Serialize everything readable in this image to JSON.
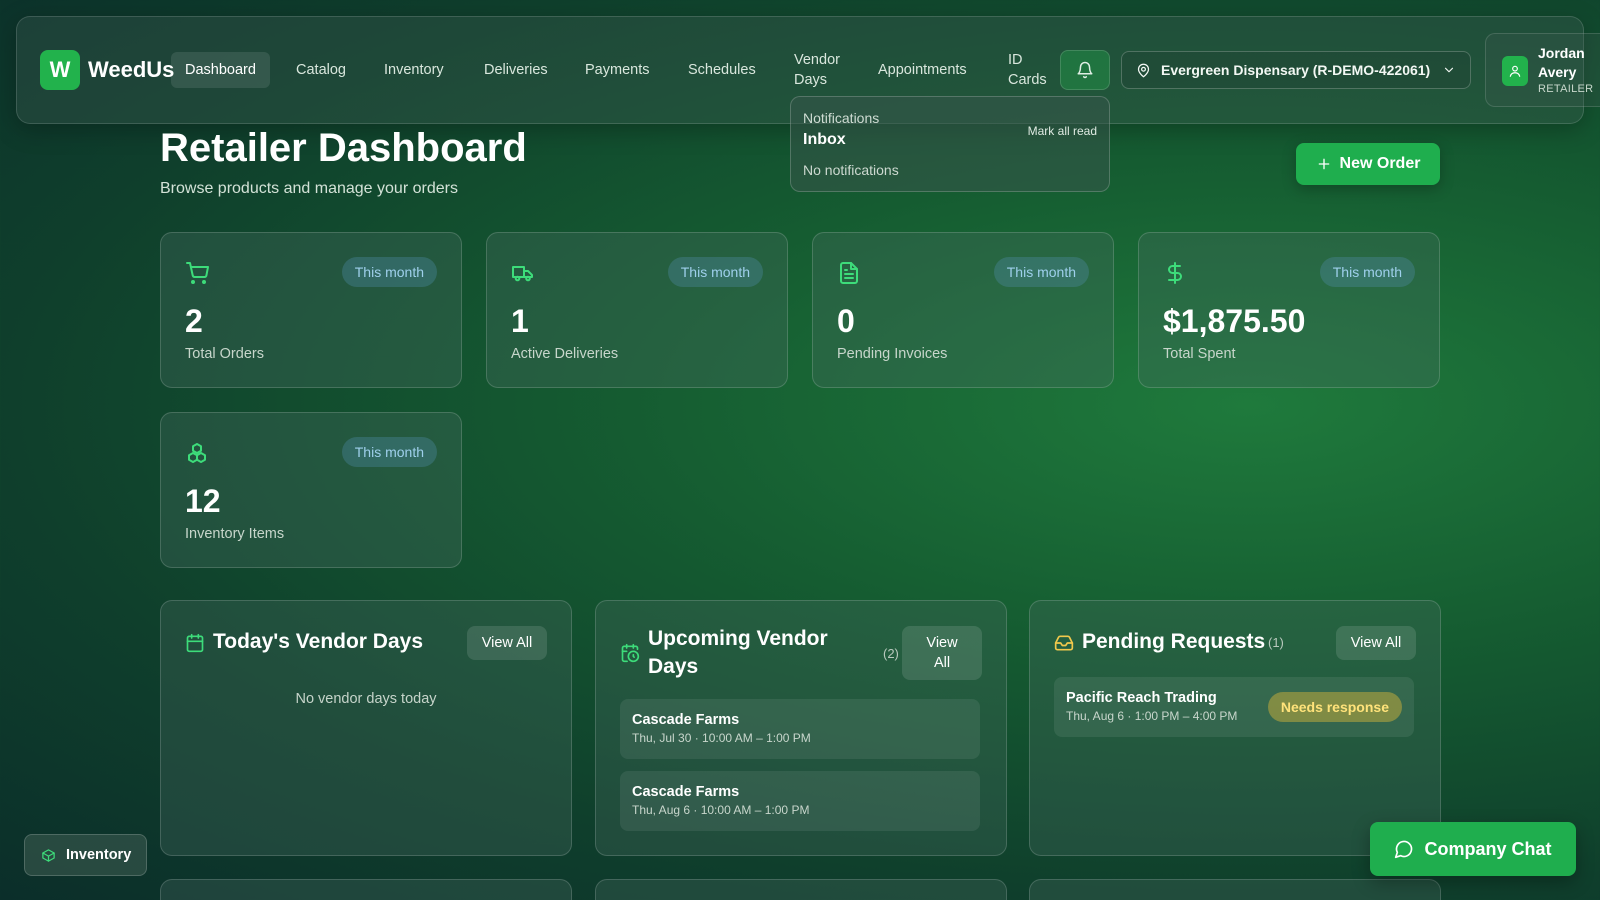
{
  "brand": {
    "logo_letter": "W",
    "name": "WeedUs"
  },
  "nav": {
    "items": [
      {
        "label": "Dashboard",
        "active": true
      },
      {
        "label": "Catalog"
      },
      {
        "label": "Inventory"
      },
      {
        "label": "Deliveries"
      },
      {
        "label": "Payments"
      },
      {
        "label": "Schedules"
      },
      {
        "label": "Vendor Days"
      },
      {
        "label": "Appointments"
      },
      {
        "label": "ID Cards"
      }
    ],
    "bell_icon": "bell-icon"
  },
  "store_selector": {
    "label": "Evergreen Dispensary (R-DEMO-422061)",
    "icon": "map-pin-icon"
  },
  "user": {
    "name": "Jordan Avery",
    "role": "RETAILER"
  },
  "notifications": {
    "heading": "Notifications",
    "title": "Inbox",
    "mark_all": "Mark all read",
    "empty": "No notifications"
  },
  "header": {
    "title": "Retailer Dashboard",
    "subtitle": "Browse products and manage your orders",
    "new_order": "New Order"
  },
  "stats": [
    {
      "icon": "cart-icon",
      "badge": "This month",
      "value": "2",
      "label": "Total Orders"
    },
    {
      "icon": "truck-icon",
      "badge": "This month",
      "value": "1",
      "label": "Active Deliveries"
    },
    {
      "icon": "document-icon",
      "badge": "This month",
      "value": "0",
      "label": "Pending Invoices"
    },
    {
      "icon": "dollar-icon",
      "badge": "This month",
      "value": "$1,875.50",
      "label": "Total Spent"
    },
    {
      "icon": "boxes-icon",
      "badge": "This month",
      "value": "12",
      "label": "Inventory Items"
    }
  ],
  "panels": {
    "today": {
      "title": "Today's Vendor Days",
      "view_all": "View All",
      "empty": "No vendor days today"
    },
    "upcoming": {
      "title": "Upcoming Vendor Days",
      "count": "(2)",
      "view_all": "View All",
      "rows": [
        {
          "name": "Cascade Farms",
          "time": "Thu, Jul 30 · 10:00 AM – 1:00 PM"
        },
        {
          "name": "Cascade Farms",
          "time": "Thu, Aug 6 · 10:00 AM – 1:00 PM"
        }
      ]
    },
    "pending": {
      "title": "Pending Requests",
      "count": "(1)",
      "view_all": "View All",
      "rows": [
        {
          "name": "Pacific Reach Trading",
          "time": "Thu, Aug 6 · 1:00 PM – 4:00 PM",
          "status": "Needs response"
        }
      ]
    }
  },
  "floating": {
    "inventory": "Inventory",
    "chat": "Company Chat"
  },
  "colors": {
    "accent": "#1fae4e",
    "icon_green": "#3ddc7a",
    "badge_blue": "#9fd0ec",
    "warn": "#ffe37a"
  }
}
